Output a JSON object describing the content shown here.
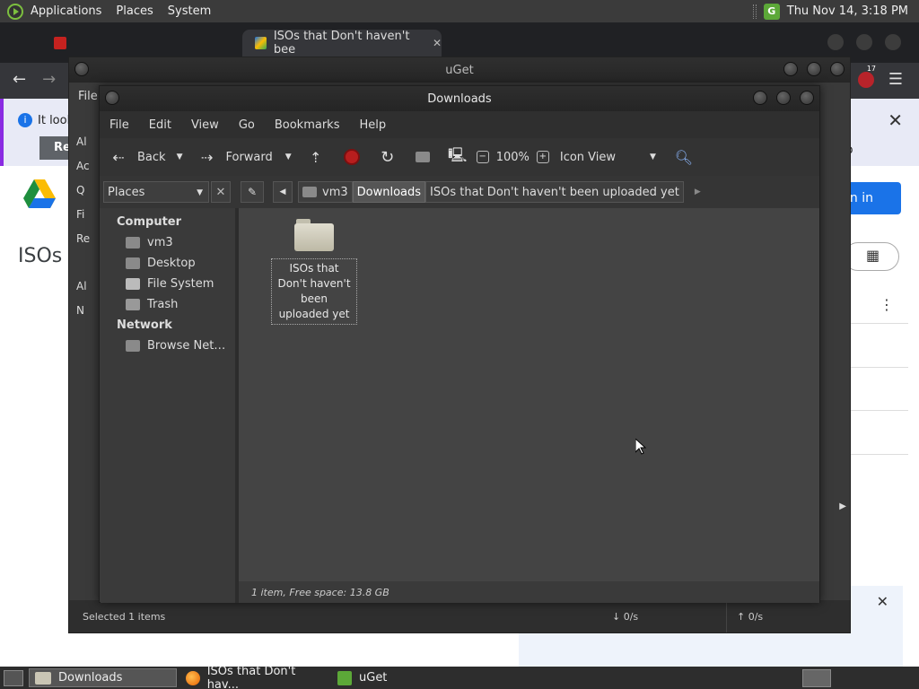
{
  "top_panel": {
    "menus": [
      "Applications",
      "Places",
      "System"
    ],
    "tray_badge": "G",
    "clock": "Thu Nov 14,  3:18 PM"
  },
  "browser": {
    "tabs": [
      {
        "label": ""
      },
      {
        "label": "ISOs that Don't haven't bee"
      }
    ],
    "tab_close": "✕",
    "ext_badge": "17",
    "info_text": "It look",
    "info_btn": "Re",
    "side_right": "Sp",
    "page_title": "ISOs",
    "signin": "gn in",
    "colors": {
      "tab_active": "#35363a",
      "signin": "#1a73e8"
    }
  },
  "uget": {
    "title": "uGet",
    "menu": "File",
    "side_items": [
      "Al",
      "Ac",
      "Q",
      "Fi",
      "Re",
      "Al",
      "N"
    ],
    "status_selected": "Selected 1 items",
    "down_rate": "↓  0/s",
    "up_rate": "↑  0/s"
  },
  "caja": {
    "title": "Downloads",
    "menu": [
      "File",
      "Edit",
      "View",
      "Go",
      "Bookmarks",
      "Help"
    ],
    "toolbar": {
      "back": "Back",
      "forward": "Forward",
      "zoom": "100%",
      "view_mode": "Icon View"
    },
    "places_combo": "Places",
    "breadcrumbs": [
      "vm3",
      "Downloads",
      "ISOs that Don't haven't been uploaded yet"
    ],
    "sidebar": {
      "computer_header": "Computer",
      "computer_items": [
        "vm3",
        "Desktop",
        "File System",
        "Trash"
      ],
      "network_header": "Network",
      "network_items": [
        "Browse Net…"
      ]
    },
    "folder": {
      "name": "ISOs that Don't haven't been uploaded yet",
      "icon": "folder-icon"
    },
    "statusbar": "1 item, Free space: 13.8 GB"
  },
  "bottom_panel": {
    "tasks": [
      {
        "label": "Downloads",
        "icon": "folder-icon"
      },
      {
        "label": "ISOs that Don't hav...",
        "icon": "firefox-icon"
      },
      {
        "label": "uGet",
        "icon": "uget-icon"
      }
    ]
  }
}
